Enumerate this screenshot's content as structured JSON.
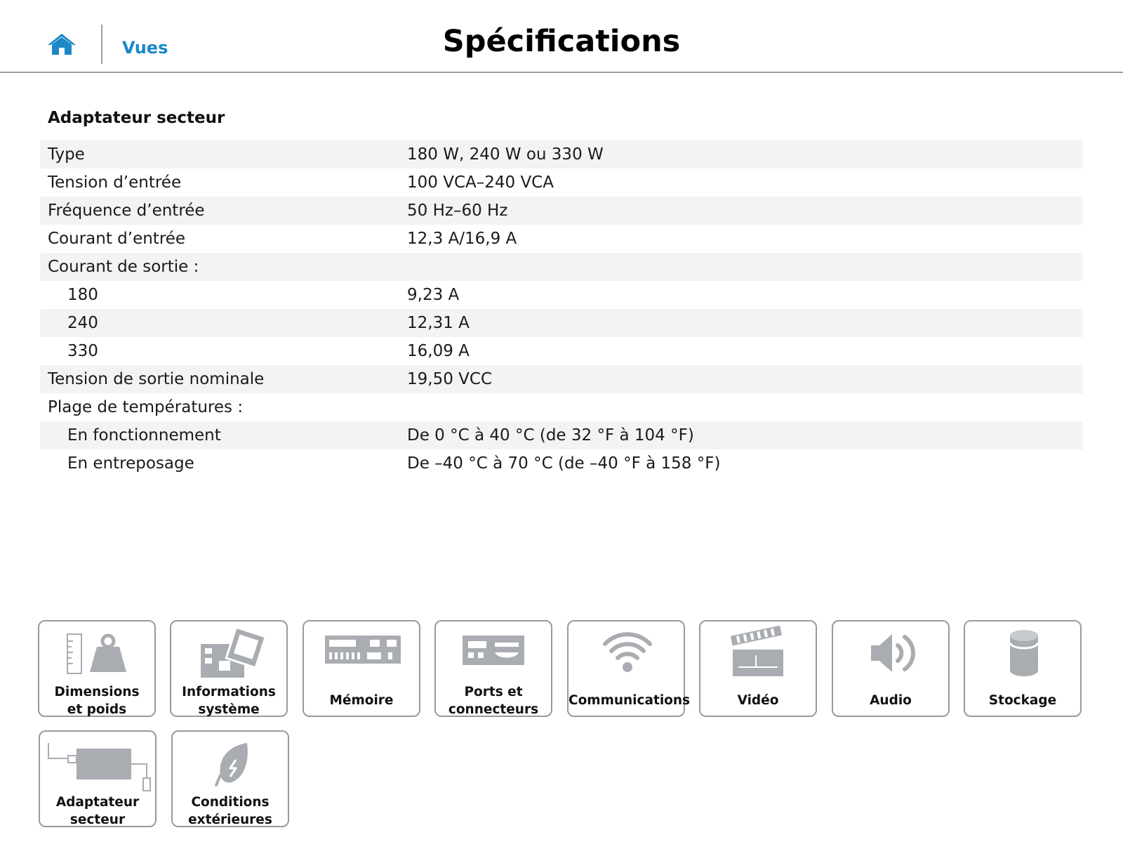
{
  "header": {
    "views_label": "Vues",
    "title": "Spécifications"
  },
  "section": {
    "title": "Adaptateur secteur",
    "rows": [
      {
        "label": "Type",
        "value": "180 W, 240 W ou 330 W"
      },
      {
        "label": "Tension d’entrée",
        "value": "100 VCA–240 VCA"
      },
      {
        "label": "Fréquence d’entrée",
        "value": "50 Hz–60 Hz"
      },
      {
        "label": "Courant d’entrée",
        "value": "12,3 A/16,9 A"
      },
      {
        "label": "Courant de sortie :",
        "value": ""
      },
      {
        "label": "180",
        "value": "9,23 A"
      },
      {
        "label": "240",
        "value": "12,31 A"
      },
      {
        "label": "330",
        "value": "16,09 A"
      },
      {
        "label": "Tension de sortie nominale",
        "value": "19,50 VCC"
      },
      {
        "label": "Plage de températures :",
        "value": ""
      },
      {
        "label": "En fonctionnement",
        "value": "De 0 °C à 40 °C (de 32 °F à 104 °F)"
      },
      {
        "label": "En entreposage",
        "value": "De –40 °C à 70 °C (de –40 °F à 158 °F)"
      }
    ]
  },
  "tiles": [
    {
      "line1": "Dimensions",
      "line2": "et poids",
      "icon": "scale-weight-icon"
    },
    {
      "line1": "Informations",
      "line2": "système",
      "icon": "circuit-board-icon"
    },
    {
      "line1": "Mémoire",
      "line2": "",
      "icon": "memory-module-icon"
    },
    {
      "line1": "Ports et",
      "line2": "connecteurs",
      "icon": "ports-icon"
    },
    {
      "line1": "Communications",
      "line2": "",
      "icon": "wifi-icon"
    },
    {
      "line1": "Vidéo",
      "line2": "",
      "icon": "clapperboard-icon"
    },
    {
      "line1": "Audio",
      "line2": "",
      "icon": "speaker-icon"
    },
    {
      "line1": "Stockage",
      "line2": "",
      "icon": "storage-cylinder-icon"
    },
    {
      "line1": "Adaptateur",
      "line2": "secteur",
      "icon": "power-adapter-icon"
    },
    {
      "line1": "Conditions",
      "line2": "extérieures",
      "icon": "leaf-icon"
    }
  ],
  "colors": {
    "accent": "#1b88c8",
    "icon_gray": "#a9adb1",
    "row_shade": "#f3f3f3"
  }
}
